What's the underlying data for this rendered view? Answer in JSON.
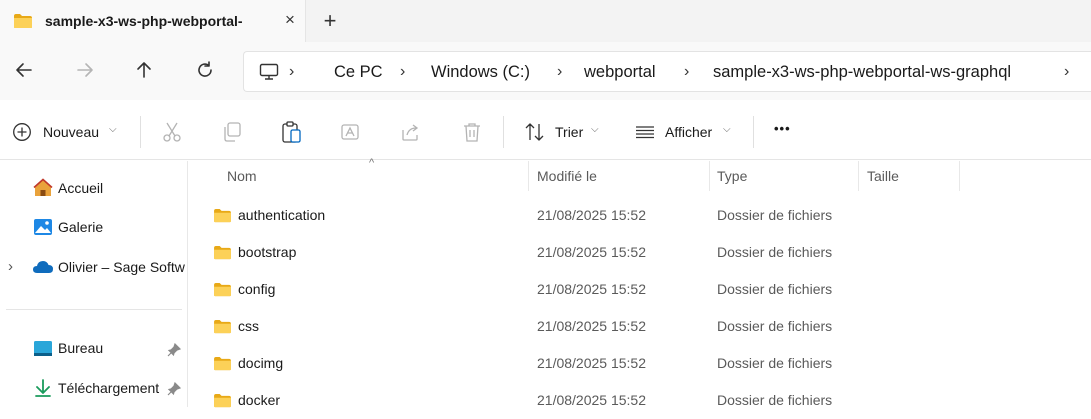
{
  "tab": {
    "title": "sample-x3-ws-php-webportal-",
    "close_icon": "×",
    "new_icon": "+"
  },
  "breadcrumb": [
    "Ce PC",
    "Windows (C:)",
    "webportal",
    "sample-x3-ws-php-webportal-ws-graphql"
  ],
  "commands": {
    "new_label": "Nouveau",
    "sort_label": "Trier",
    "view_label": "Afficher",
    "more_label": "•••"
  },
  "nav": {
    "items": [
      {
        "label": "Accueil",
        "icon": "home-icon"
      },
      {
        "label": "Galerie",
        "icon": "gallery-icon"
      },
      {
        "label": "Olivier – Sage Softw",
        "icon": "onedrive-icon"
      },
      {
        "label": "Bureau",
        "icon": "desktop-icon"
      },
      {
        "label": "Téléchargement",
        "icon": "download-icon"
      }
    ]
  },
  "columns": {
    "name": "Nom",
    "modified": "Modifié le",
    "type": "Type",
    "size": "Taille"
  },
  "rows": [
    {
      "name": "authentication",
      "modified": "21/08/2025 15:52",
      "type": "Dossier de fichiers"
    },
    {
      "name": "bootstrap",
      "modified": "21/08/2025 15:52",
      "type": "Dossier de fichiers"
    },
    {
      "name": "config",
      "modified": "21/08/2025 15:52",
      "type": "Dossier de fichiers"
    },
    {
      "name": "css",
      "modified": "21/08/2025 15:52",
      "type": "Dossier de fichiers"
    },
    {
      "name": "docimg",
      "modified": "21/08/2025 15:52",
      "type": "Dossier de fichiers"
    },
    {
      "name": "docker",
      "modified": "21/08/2025 15:52",
      "type": "Dossier de fichiers"
    }
  ],
  "colors": {
    "folder": "#f5c542",
    "accent": "#0067c0"
  }
}
